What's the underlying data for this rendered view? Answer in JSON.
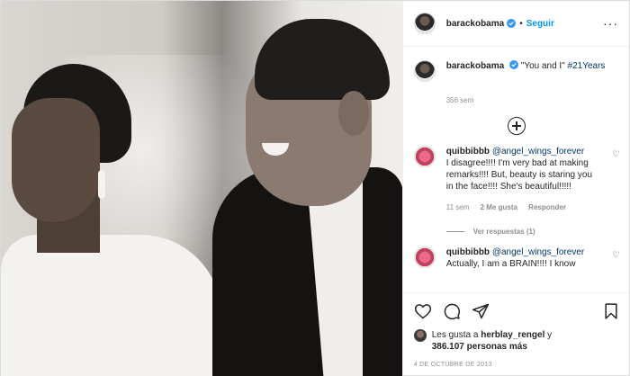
{
  "header": {
    "username": "barackobama",
    "separator": "•",
    "follow_label": "Seguir",
    "more_label": "···"
  },
  "caption": {
    "username": "barackobama",
    "text": "\"You and I\"",
    "hashtag": "#21Years",
    "age": "356 sem"
  },
  "load_more_icon": "plus-circle-icon",
  "comments": [
    {
      "username": "quibbibbb",
      "mention": "@angel_wings_forever",
      "text": "I disagree!!!! I'm very bad at making remarks!!!! But, beauty is staring you in the face!!!! She's beautiful!!!!!",
      "age": "11 sem",
      "likes": "2 Me gusta",
      "reply_label": "Responder",
      "view_replies": "Ver respuestas (1)"
    },
    {
      "username": "quibbibbb",
      "mention": "@angel_wings_forever",
      "text": "Actually, I am a BRAIN!!!! I know"
    }
  ],
  "actions": {
    "like_icon": "heart-icon",
    "comment_icon": "comment-icon",
    "share_icon": "share-icon",
    "save_icon": "bookmark-icon"
  },
  "likes": {
    "prefix": "Les gusta a",
    "user": "herblay_rengel",
    "conj": "y",
    "count": "386.107 personas más"
  },
  "date": "4 DE OCTUBRE DE 2013",
  "colors": {
    "link": "#0095f6",
    "mention": "#00376b",
    "muted": "#8e8e8e",
    "verified": "#3897f0"
  }
}
